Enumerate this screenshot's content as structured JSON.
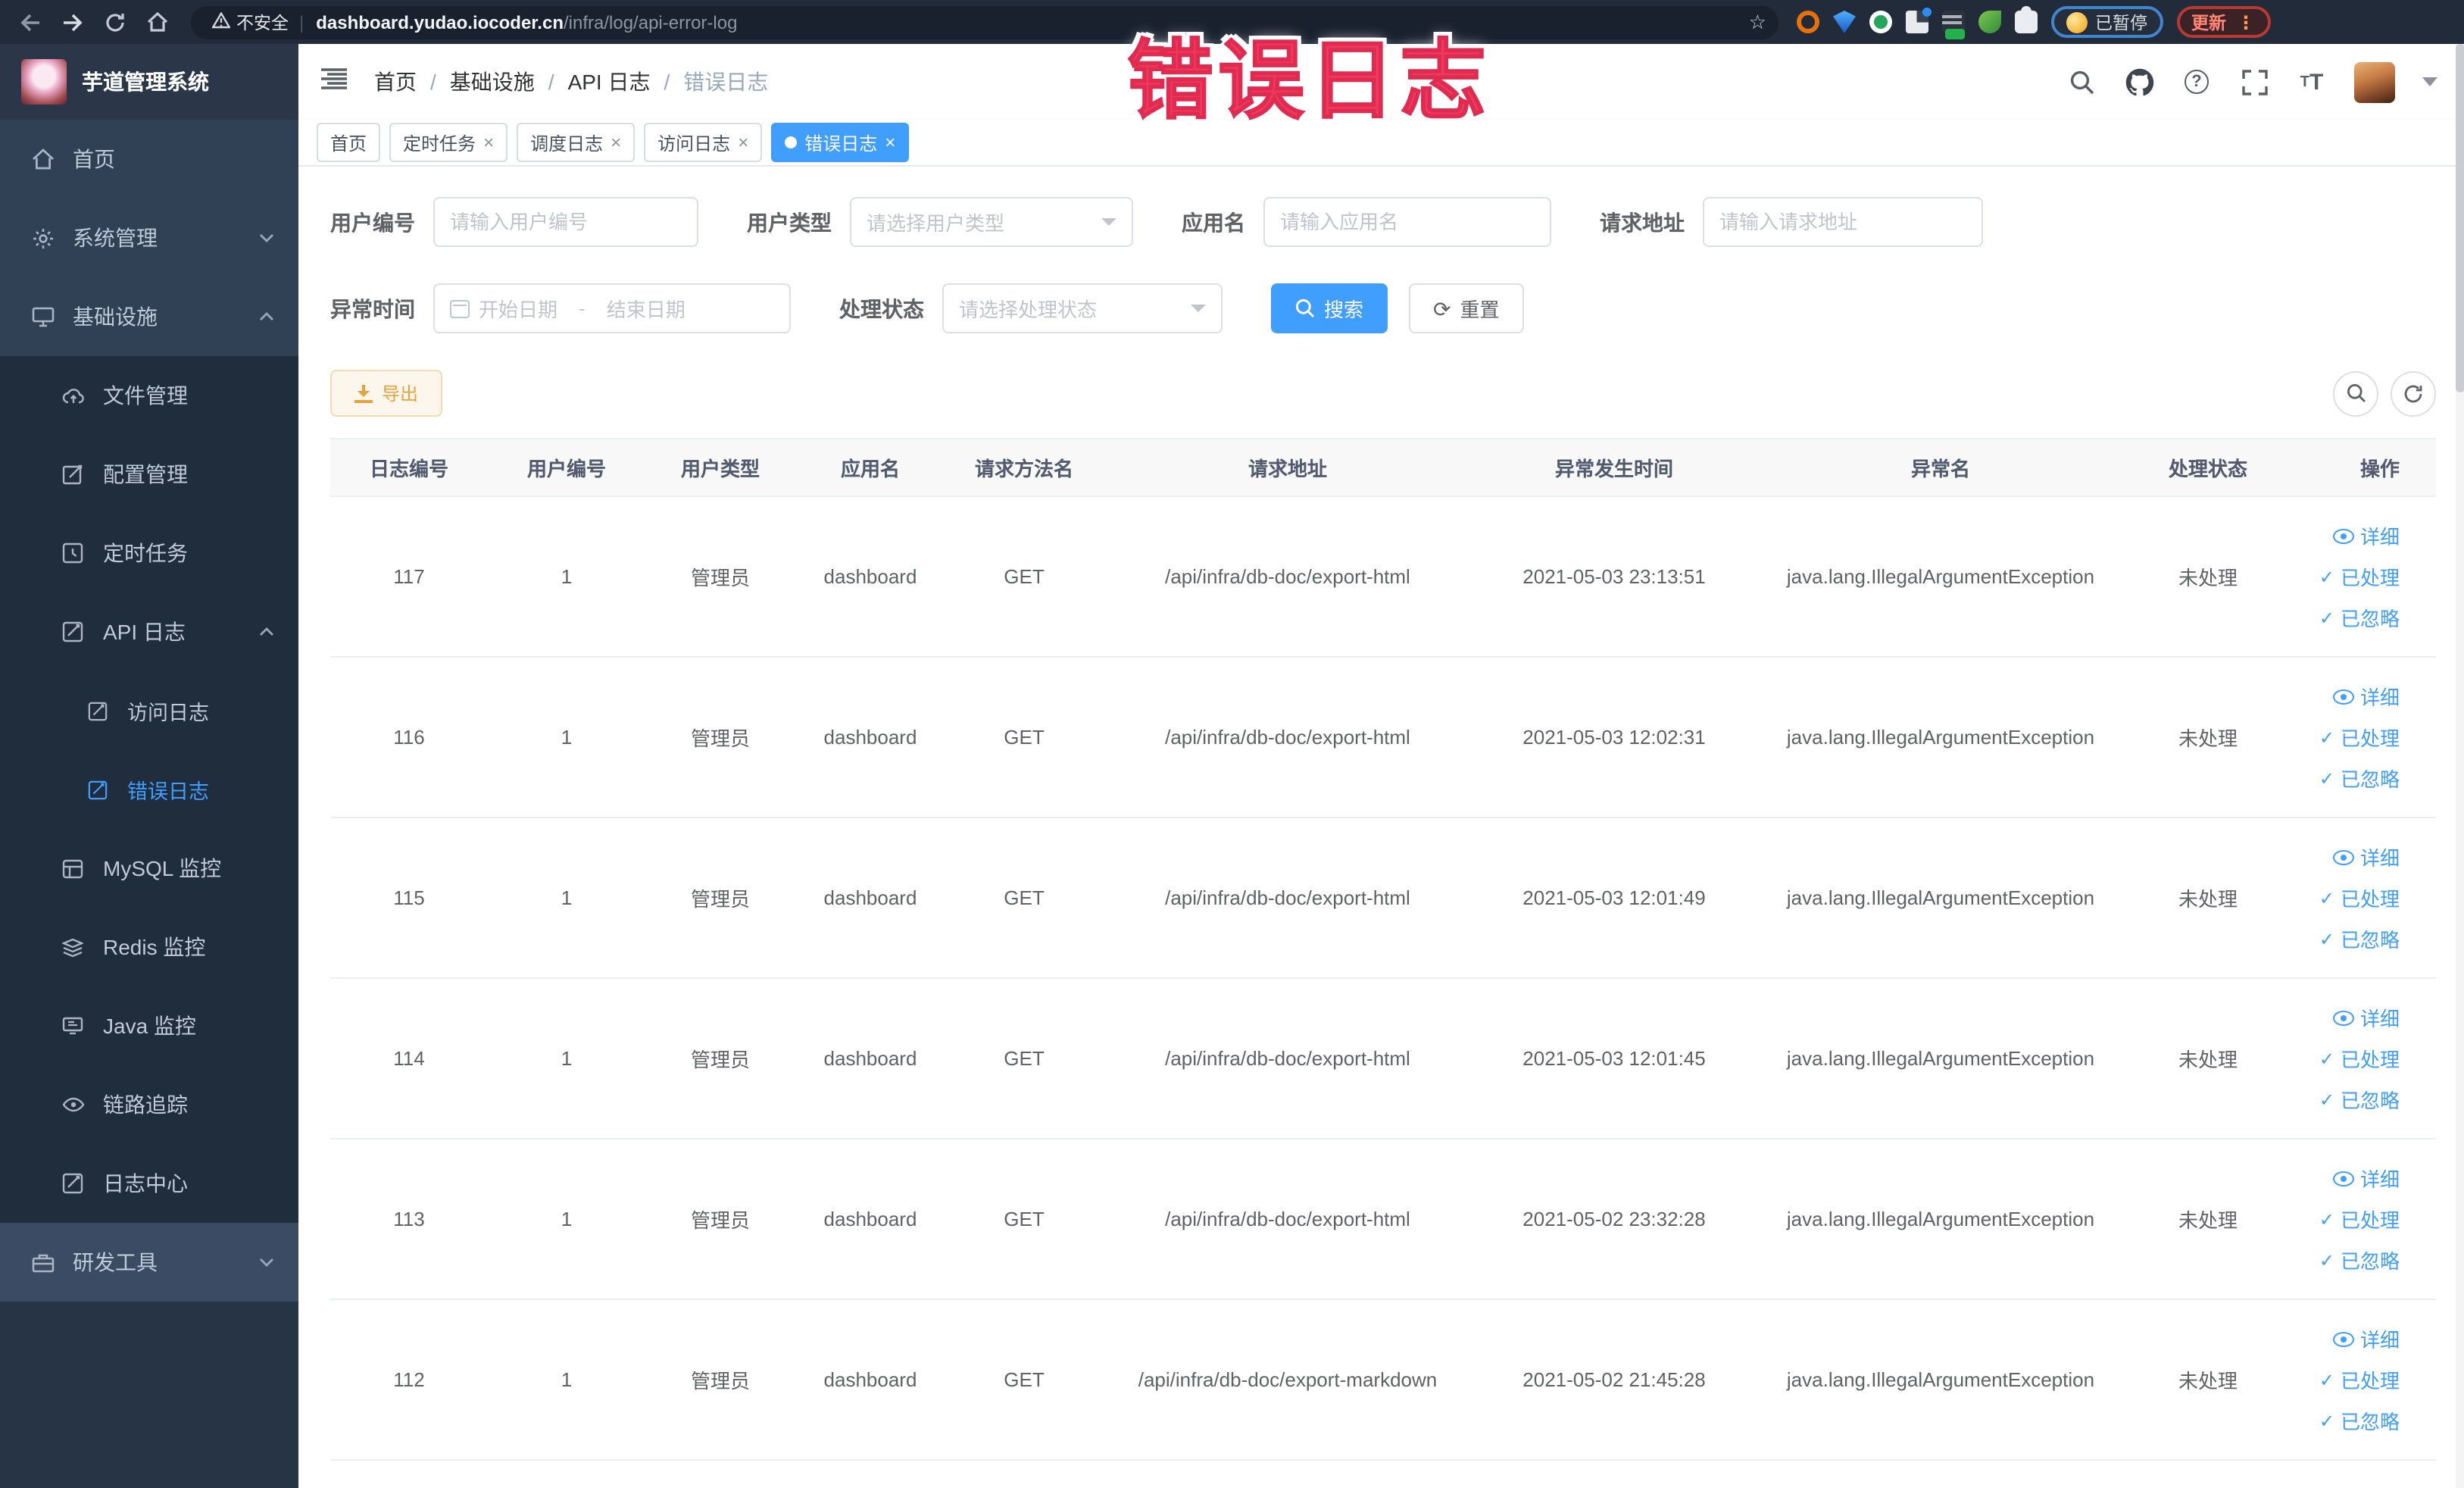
{
  "browser": {
    "security_label": "不安全",
    "url_host": "dashboard.yudao.iocoder.cn",
    "url_path": "/infra/log/api-error-log",
    "paused_badge": "已暂停",
    "update_badge": "更新"
  },
  "overlay_title": "错误日志",
  "icons": {
    "close": "×",
    "kebab": "⋮",
    "star": "☆",
    "warning": "⚠",
    "omni_separator": "|",
    "breadcrumb_separator": "/",
    "check": "✓",
    "refresh": "⟳",
    "question": "?",
    "font_size_big": "T",
    "font_size_small": "T"
  },
  "sidebar": {
    "logo_title": "芋道管理系统",
    "items": [
      {
        "label": "首页"
      },
      {
        "label": "系统管理"
      },
      {
        "label": "基础设施"
      },
      {
        "label": "文件管理"
      },
      {
        "label": "配置管理"
      },
      {
        "label": "定时任务"
      },
      {
        "label": "API 日志"
      },
      {
        "label": "访问日志"
      },
      {
        "label": "错误日志"
      },
      {
        "label": "MySQL 监控"
      },
      {
        "label": "Redis 监控"
      },
      {
        "label": "Java 监控"
      },
      {
        "label": "链路追踪"
      },
      {
        "label": "日志中心"
      },
      {
        "label": "研发工具"
      }
    ]
  },
  "breadcrumb": {
    "items": [
      {
        "label": "首页"
      },
      {
        "label": "基础设施"
      },
      {
        "label": "API 日志"
      },
      {
        "label": "错误日志"
      }
    ]
  },
  "tags": {
    "items": [
      {
        "label": "首页"
      },
      {
        "label": "定时任务"
      },
      {
        "label": "调度日志"
      },
      {
        "label": "访问日志"
      },
      {
        "label": "错误日志"
      }
    ]
  },
  "filters": {
    "user_id_label": "用户编号",
    "user_id_placeholder": "请输入用户编号",
    "user_type_label": "用户类型",
    "user_type_placeholder": "请选择用户类型",
    "app_name_label": "应用名",
    "app_name_placeholder": "请输入应用名",
    "request_url_label": "请求地址",
    "request_url_placeholder": "请输入请求地址",
    "exception_time_label": "异常时间",
    "date_start_placeholder": "开始日期",
    "date_separator": "-",
    "date_end_placeholder": "结束日期",
    "process_status_label": "处理状态",
    "process_status_placeholder": "请选择处理状态",
    "search_button": "搜索",
    "reset_button": "重置"
  },
  "toolbar": {
    "export_button": "导出"
  },
  "table": {
    "columns": [
      "日志编号",
      "用户编号",
      "用户类型",
      "应用名",
      "请求方法名",
      "请求地址",
      "异常发生时间",
      "异常名",
      "处理状态",
      "操作"
    ],
    "action_labels": [
      "详细",
      "已处理",
      "已忽略"
    ],
    "rows": [
      {
        "id": "117",
        "user_id": "1",
        "user_type": "管理员",
        "app_name": "dashboard",
        "method": "GET",
        "url": "/api/infra/db-doc/export-html",
        "time": "2021-05-03 23:13:51",
        "exception": "java.lang.IllegalArgumentException",
        "status": "未处理"
      },
      {
        "id": "116",
        "user_id": "1",
        "user_type": "管理员",
        "app_name": "dashboard",
        "method": "GET",
        "url": "/api/infra/db-doc/export-html",
        "time": "2021-05-03 12:02:31",
        "exception": "java.lang.IllegalArgumentException",
        "status": "未处理"
      },
      {
        "id": "115",
        "user_id": "1",
        "user_type": "管理员",
        "app_name": "dashboard",
        "method": "GET",
        "url": "/api/infra/db-doc/export-html",
        "time": "2021-05-03 12:01:49",
        "exception": "java.lang.IllegalArgumentException",
        "status": "未处理"
      },
      {
        "id": "114",
        "user_id": "1",
        "user_type": "管理员",
        "app_name": "dashboard",
        "method": "GET",
        "url": "/api/infra/db-doc/export-html",
        "time": "2021-05-03 12:01:45",
        "exception": "java.lang.IllegalArgumentException",
        "status": "未处理"
      },
      {
        "id": "113",
        "user_id": "1",
        "user_type": "管理员",
        "app_name": "dashboard",
        "method": "GET",
        "url": "/api/infra/db-doc/export-html",
        "time": "2021-05-02 23:32:28",
        "exception": "java.lang.IllegalArgumentException",
        "status": "未处理"
      },
      {
        "id": "112",
        "user_id": "1",
        "user_type": "管理员",
        "app_name": "dashboard",
        "method": "GET",
        "url": "/api/infra/db-doc/export-markdown",
        "time": "2021-05-02 21:45:28",
        "exception": "java.lang.IllegalArgumentException",
        "status": "未处理"
      }
    ]
  },
  "colors": {
    "primary": "#409eff",
    "sidebar_bg": "#304156",
    "sidebar_sub_bg": "#1f2d3d",
    "warning_text": "#e6a23c",
    "overlay_red": "#ee3a5f",
    "browser_bar_bg": "#212b3a"
  }
}
